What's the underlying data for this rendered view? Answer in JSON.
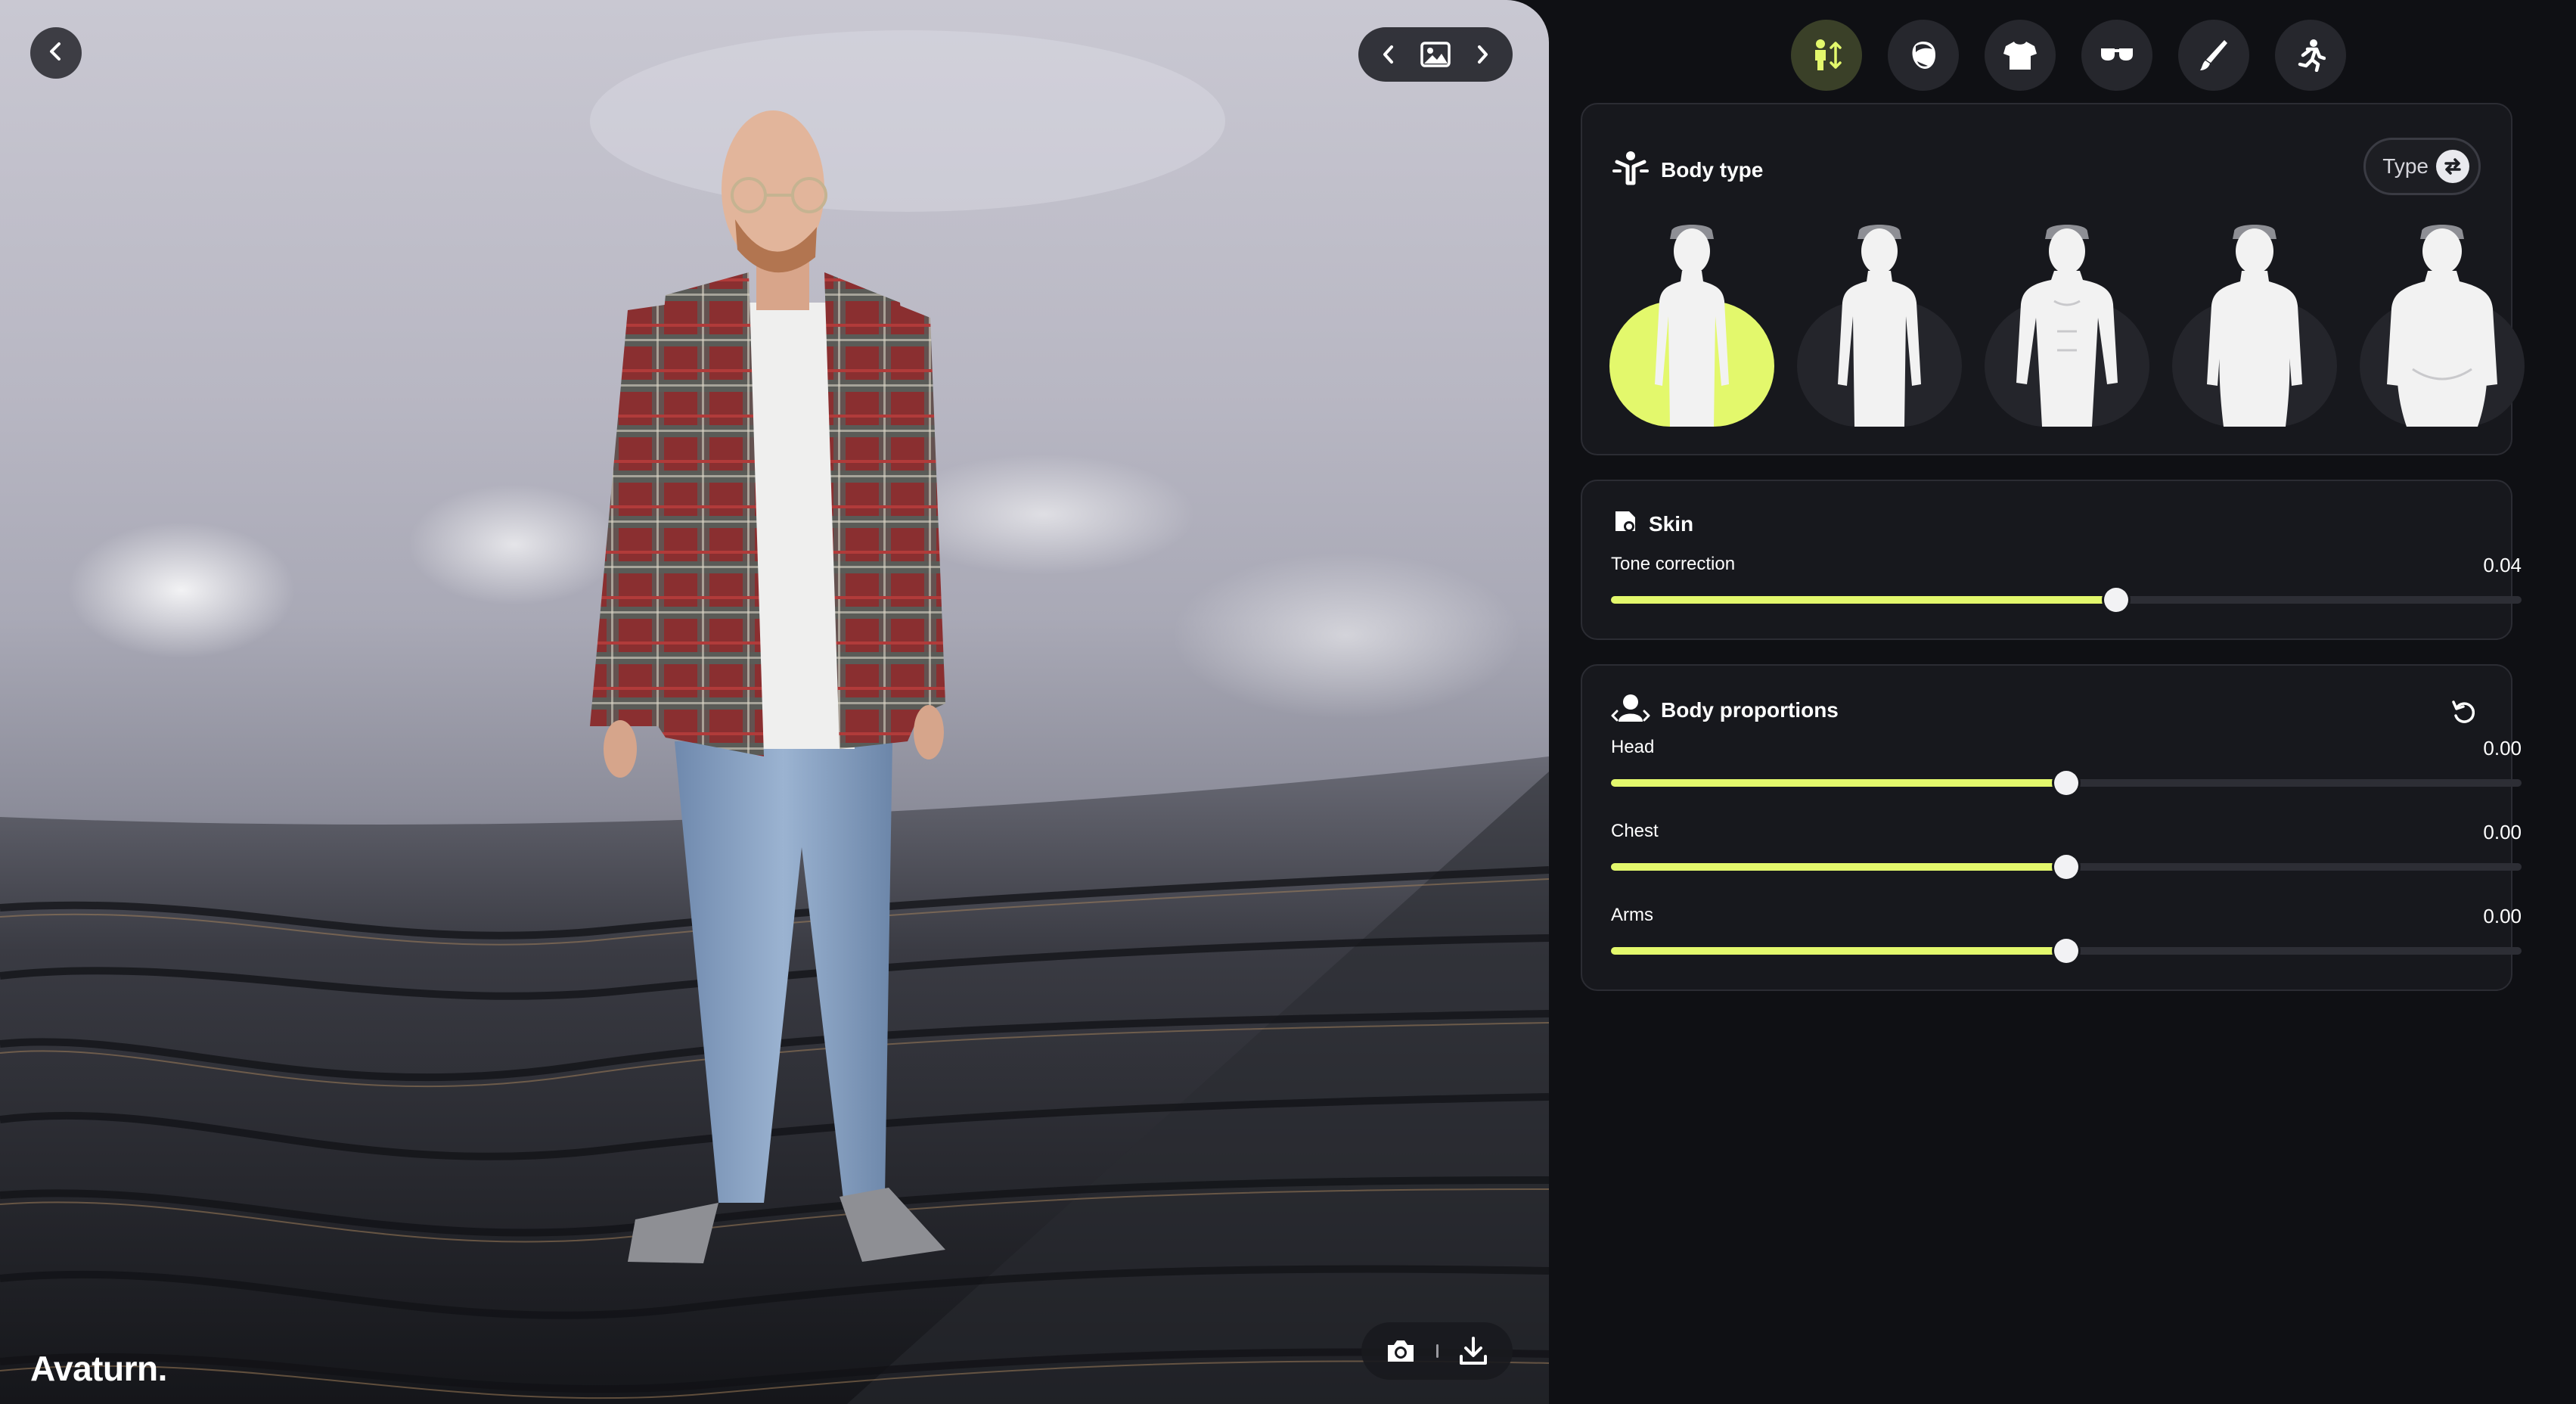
{
  "app": {
    "brand": "Avaturn."
  },
  "viewport": {
    "icons": {
      "back": "chevron-left-icon",
      "prev_scene": "chevron-left-icon",
      "scene": "image-icon",
      "next_scene": "chevron-right-icon",
      "screenshot": "camera-icon",
      "download": "download-icon"
    }
  },
  "tabs": [
    {
      "name": "body",
      "icon": "body-resize-icon",
      "active": true
    },
    {
      "name": "head",
      "icon": "head-icon",
      "active": false
    },
    {
      "name": "clothes",
      "icon": "tshirt-icon",
      "active": false
    },
    {
      "name": "accessories",
      "icon": "glasses-icon",
      "active": false
    },
    {
      "name": "makeup",
      "icon": "brush-icon",
      "active": false
    },
    {
      "name": "animation",
      "icon": "running-person-icon",
      "active": false
    }
  ],
  "body_type": {
    "title": "Body type",
    "type_button": "Type",
    "options": [
      {
        "name": "slim",
        "selected": true
      },
      {
        "name": "average",
        "selected": false
      },
      {
        "name": "athletic",
        "selected": false
      },
      {
        "name": "heavy",
        "selected": false
      },
      {
        "name": "plus",
        "selected": false
      }
    ]
  },
  "skin": {
    "title": "Skin",
    "sliders": [
      {
        "label": "Tone correction",
        "value": "0.04",
        "position": 0.555
      }
    ]
  },
  "body_proportions": {
    "title": "Body proportions",
    "sliders": [
      {
        "label": "Head",
        "value": "0.00",
        "position": 0.5
      },
      {
        "label": "Chest",
        "value": "0.00",
        "position": 0.5
      },
      {
        "label": "Arms",
        "value": "0.00",
        "position": 0.5
      }
    ]
  },
  "colors": {
    "accent": "#e3f86c",
    "panel_bg": "#0f1014",
    "card_bg": "#17181d"
  }
}
